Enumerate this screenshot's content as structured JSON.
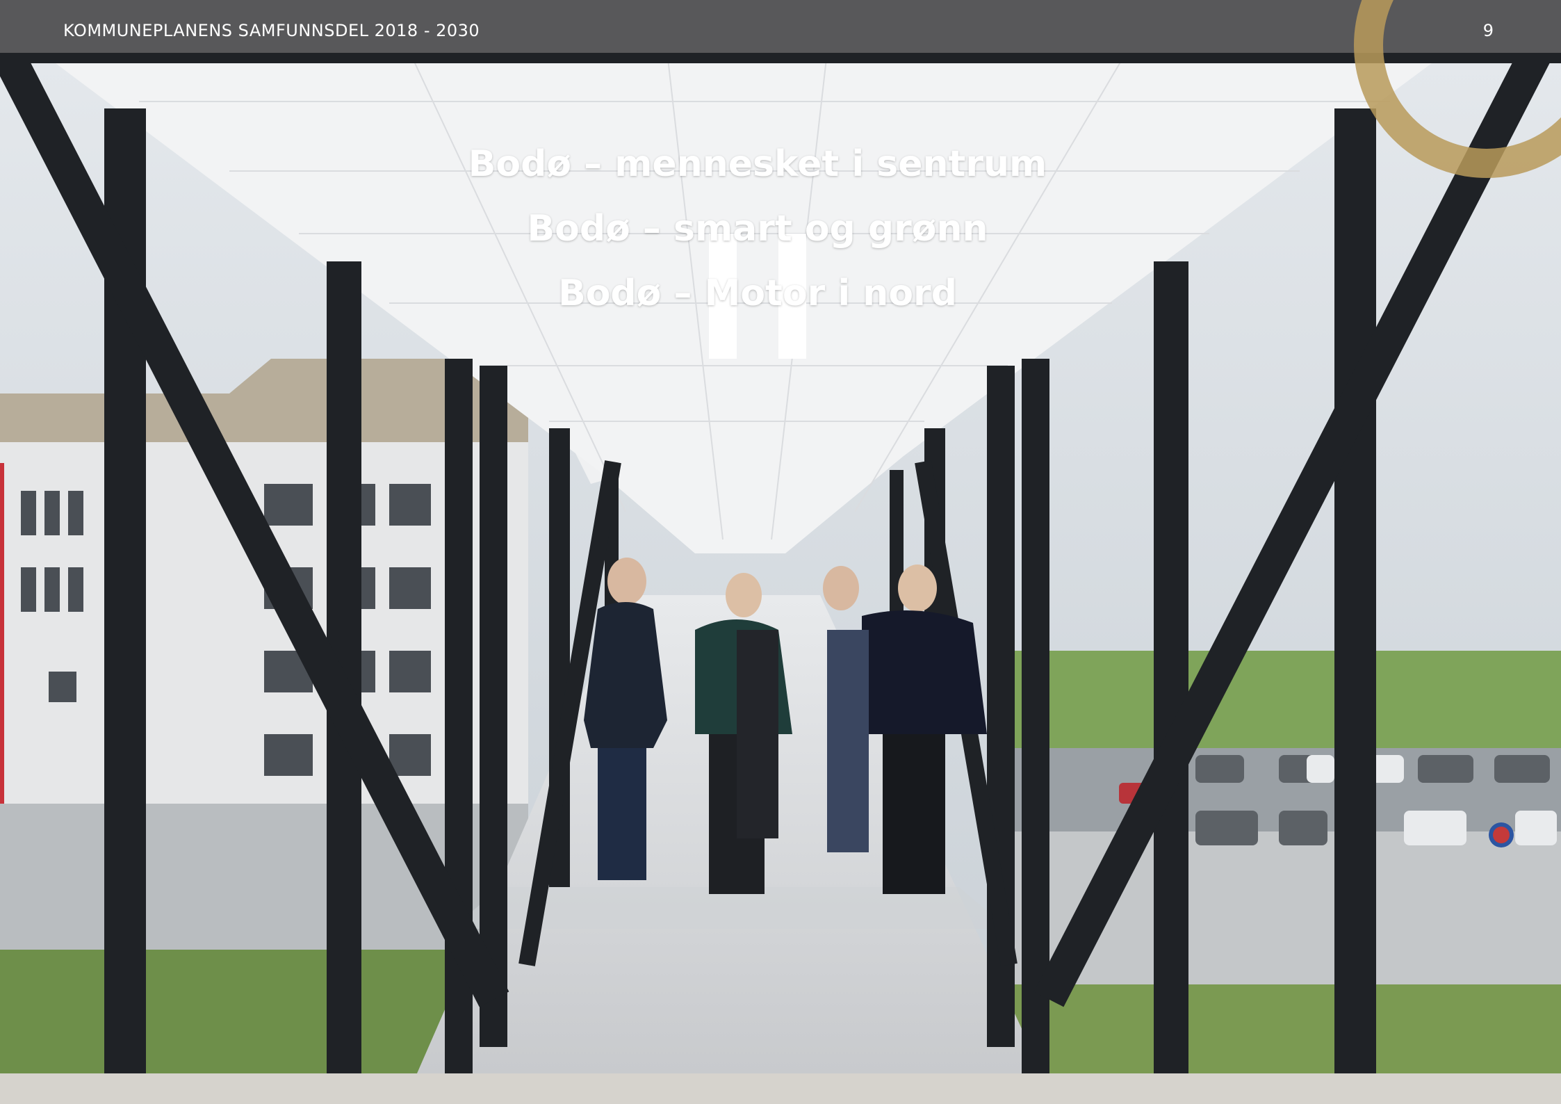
{
  "header": {
    "title": "KOMMUNEPLANENS SAMFUNNSDEL 2018 - 2030",
    "page_number": "9"
  },
  "slogans": [
    "Bodø – mennesket i sentrum",
    "Bodø – smart og grønn",
    "Bodø – Motor i nord"
  ],
  "colors": {
    "header_bg": "#58585a",
    "accent_gold": "#b89a5a",
    "footer_band": "#d6d3cd"
  }
}
